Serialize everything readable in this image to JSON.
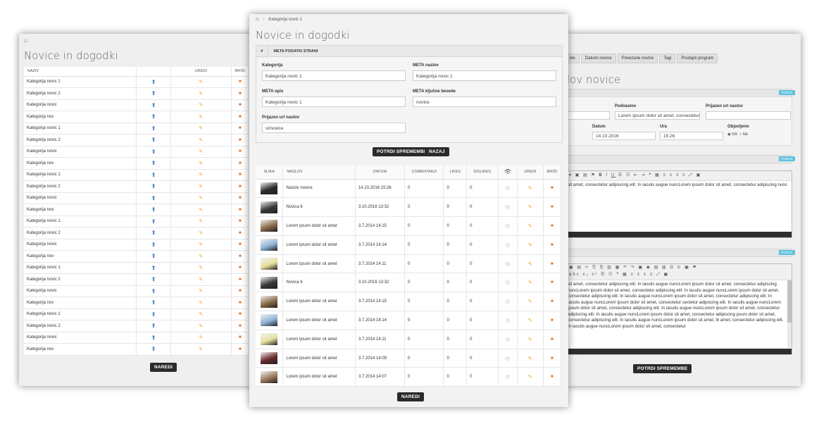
{
  "left": {
    "title": "Novice in dogodki",
    "headers": [
      "NAZIV",
      "",
      "UREDI",
      "BRIŠI"
    ],
    "rows": [
      "Kategorija novic 1",
      "Kategorija novic 2",
      "Kategorija novic",
      "Kategorija nov",
      "Kategorija novic 1",
      "Kategorija novic 2",
      "Kategorija novic",
      "Kategorija nov",
      "Kategorija novic 1",
      "Kategorija novic 2",
      "Kategorija novic",
      "Kategorija nov",
      "Kategorija novic 1",
      "Kategorija novic 2",
      "Kategorija novic",
      "Kategorija nov",
      "Kategorija novic 1",
      "Kategorija novic 2",
      "Kategorija novic",
      "Kategorija nov",
      "Kategorija novic 1",
      "Kategorija novic 2",
      "Kategorija novic",
      "Kategorija nov"
    ],
    "button": "NAREDI"
  },
  "right": {
    "tabs": [
      "ike",
      "Datumi novice",
      "Povezane novice",
      "Tagi",
      "Prodajni program"
    ],
    "title": "lov novice",
    "help": "POMOČ",
    "podnaslov_label": "Podnaslov",
    "podnaslov_value": "Lorem ipsum dolor sit amet, consectetur a",
    "url_label": "Prijazen url naslov",
    "datum_label": "Datum",
    "datum_value": "14.10.2016",
    "ura_label": "Ura",
    "ura_value": "15:26",
    "objavljeno_label": "Objavljeno",
    "da": "DA",
    "ne": "NE",
    "editor1_text": "sit amet, consectetur adipiscing elit. In iaculis augue nuncLorem ipsum dolor sit amet, consectetur adipiscing nunc",
    "editor2_text": "sit amet, consectetur adipiscing elit. In iaculis augue nuncLorem ipsum dolor sit amet, consectetur adipiscing nuncLorem ipsum dolor sit amet, consectetur adipiscing elit. In iaculis augue nuncLorem ipsum dolor sit amet, consectetur adipiscing elit. In iaculis augue nuncLorem ipsum dolor sit amet, consectetur adipiscing elit. In iaculis augue nuncLorem ipsum dolor sit amet, consectetur sectetur adipiscing elit. In iaculis augue nuncLorem ipsum dolor sit amet, consectetur adipiscing elit. In iaculis augue nuncLorem ipsum dolor sit amet, consectetur adipiscing elit. In iaculis augue nuncLorem ipsum dolor sit amet, consectetur adipiscing psum dolor sit amet, consectetur adipiscing elit. In iaculis augue nuncLorem ipsum dolor sit amet, lit amet, consectetur adipiscing elit. In iaculis augue nuncLorem ipsum dolor sit amet, consectetur",
    "button": "POTRDI SPREMEMBE"
  },
  "center": {
    "breadcrumb": "Kategorija novic 1",
    "title": "Novice in dogodki",
    "meta_header": "META PODATKI STRANI",
    "fields": {
      "kategorija_label": "Kategorija",
      "kategorija_value": "Kategorija novic 1",
      "meta_naslov_label": "META naslov",
      "meta_naslov_value": "Kategorija novic 1",
      "meta_opis_label": "META opis",
      "meta_opis_value": "Kategorija novic 1",
      "meta_kljucne_label": "META ključne besede",
      "meta_kljucne_value": "novice",
      "url_label": "Prijazen url naslov",
      "url_value": "sl/novice"
    },
    "btn_save": "POTRDI SPREMEMBE",
    "btn_back": "NAZAJ",
    "headers": [
      "SLIKA",
      "NASLOV",
      "DATUM",
      "COMENTARJI",
      "LIKES",
      "DISLIKES",
      "",
      "UREDI",
      "BRIŠI"
    ],
    "rows": [
      {
        "title": "Naslov novice",
        "date": "14.10.2016 15:26",
        "c": "0",
        "l": "0",
        "d": "0",
        "thumb": "#2c2c2c"
      },
      {
        "title": "Novica 6",
        "date": "3.10.2016 13:32",
        "c": "0",
        "l": "0",
        "d": "0",
        "thumb": "#3a3a3a"
      },
      {
        "title": "Lorem ipsum dolor sit amet",
        "date": "3.7.2014 14:15",
        "c": "0",
        "l": "0",
        "d": "0",
        "thumb": "#8a6a4a"
      },
      {
        "title": "Lorem ipsum dolor sit amet",
        "date": "3.7.2014 14:14",
        "c": "0",
        "l": "0",
        "d": "0",
        "thumb": "#8fb3d8"
      },
      {
        "title": "Lorem ipsum dolor sit amet",
        "date": "3.7.2014 14:11",
        "c": "0",
        "l": "0",
        "d": "0",
        "thumb": "#e8e0a0"
      },
      {
        "title": "Novica 6",
        "date": "3.10.2016 13:32",
        "c": "0",
        "l": "0",
        "d": "0",
        "thumb": "#3a3a3a"
      },
      {
        "title": "Lorem ipsum dolor sit amet",
        "date": "3.7.2014 14:15",
        "c": "0",
        "l": "0",
        "d": "0",
        "thumb": "#8a6a4a"
      },
      {
        "title": "Lorem ipsum dolor sit amet",
        "date": "3.7.2014 14:14",
        "c": "0",
        "l": "0",
        "d": "0",
        "thumb": "#8fb3d8"
      },
      {
        "title": "Lorem ipsum dolor sit amet",
        "date": "3.7.2014 14:11",
        "c": "0",
        "l": "0",
        "d": "0",
        "thumb": "#e8e0a0"
      },
      {
        "title": "Lorem ipsum dolor sit amet",
        "date": "3.7.2014 14:09",
        "c": "0",
        "l": "0",
        "d": "0",
        "thumb": "#6a2a2a"
      },
      {
        "title": "Lorem ipsum dolor sit amet",
        "date": "3.7.2014 14:07",
        "c": "0",
        "l": "0",
        "d": "0",
        "thumb": "#9a7a5a"
      }
    ],
    "button": "NAREDI"
  }
}
